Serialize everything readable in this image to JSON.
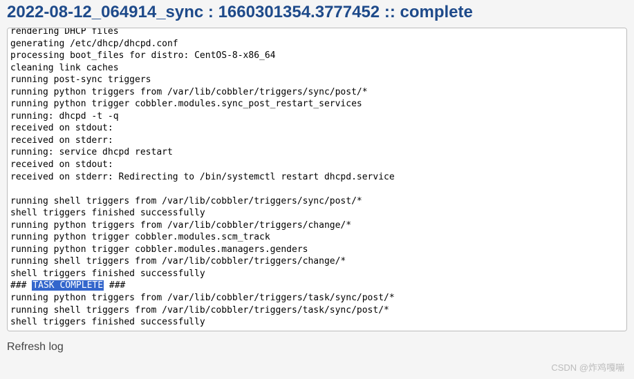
{
  "header": {
    "title": "2022-08-12_064914_sync : 1660301354.3777452 :: complete"
  },
  "log": {
    "lines": [
      "rendering DHCP files",
      "generating /etc/dhcp/dhcpd.conf",
      "processing boot_files for distro: CentOS-8-x86_64",
      "cleaning link caches",
      "running post-sync triggers",
      "running python triggers from /var/lib/cobbler/triggers/sync/post/*",
      "running python trigger cobbler.modules.sync_post_restart_services",
      "running: dhcpd -t -q",
      "received on stdout:",
      "received on stderr:",
      "running: service dhcpd restart",
      "received on stdout:",
      "received on stderr: Redirecting to /bin/systemctl restart dhcpd.service",
      "",
      "running shell triggers from /var/lib/cobbler/triggers/sync/post/*",
      "shell triggers finished successfully",
      "running python triggers from /var/lib/cobbler/triggers/change/*",
      "running python trigger cobbler.modules.scm_track",
      "running python trigger cobbler.modules.managers.genders",
      "running shell triggers from /var/lib/cobbler/triggers/change/*",
      "shell triggers finished successfully"
    ],
    "task_complete_prefix": "### ",
    "task_complete_highlight": "TASK COMPLETE",
    "task_complete_suffix": " ###",
    "lines_after": [
      "running python triggers from /var/lib/cobbler/triggers/task/sync/post/*",
      "running shell triggers from /var/lib/cobbler/triggers/task/sync/post/*",
      "shell triggers finished successfully"
    ]
  },
  "actions": {
    "refresh_label": "Refresh log"
  },
  "watermark": {
    "text": "CSDN @炸鸡嘎嘣"
  }
}
